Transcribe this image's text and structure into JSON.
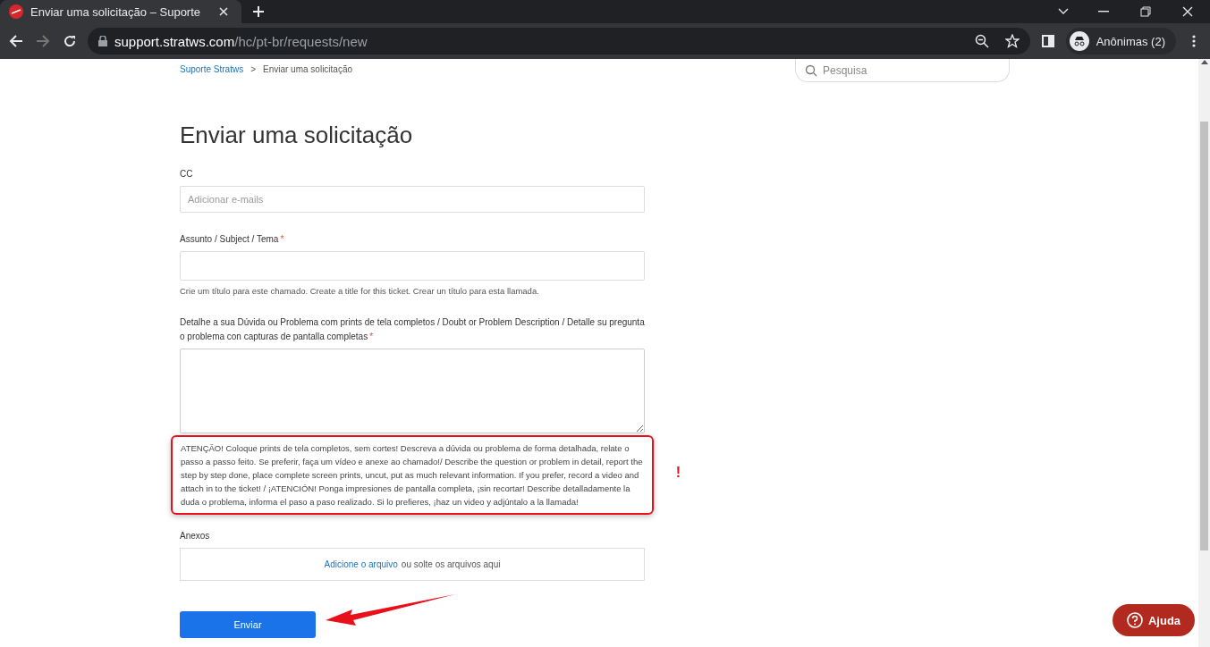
{
  "browser": {
    "tab_title": "Enviar uma solicitação – Suporte",
    "url_host": "support.stratws.com",
    "url_path": "/hc/pt-br/requests/new",
    "profile": "Anônimas (2)"
  },
  "breadcrumbs": [
    {
      "label": "Suporte Stratws",
      "kind": "link"
    },
    {
      "label": ">",
      "kind": "separator"
    },
    {
      "label": "Enviar uma solicitação",
      "kind": "current"
    }
  ],
  "search": {
    "placeholder": "Pesquisa"
  },
  "page_title": "Enviar uma solicitação",
  "fields": [
    {
      "kind": "input",
      "label": "CC",
      "placeholder": "Adicionar e-mails"
    },
    {
      "kind": "input",
      "label": "Assunto / Subject / Tema",
      "required_mark": "*",
      "hint": "Crie um título para este chamado. Create a title for this ticket. Crear un título para esta llamada."
    },
    {
      "kind": "textarea",
      "label": "Detalhe a sua Dúvida ou Problema com prints de tela completos / Doubt or Problem Description / Detalle su pregunta o problema con capturas de pantalla completas",
      "required_mark": "*",
      "warning": "ATENÇÃO! Coloque prints de tela completos, sem cortes! Descreva a dúvida ou problema de forma detalhada, relate o passo a passo feito. Se preferir, faça um vídeo e anexe ao chamado!/ Describe the question or problem in detail, report the step by step done, place complete screen prints, uncut, put as much relevant information. If you prefer, record a video and attach in to the ticket! / ¡ATENCIÓN! Ponga impresiones de pantalla completa, ¡sin recortar! Describe detalladamente la duda o problema, informa el paso a paso realizado. Si lo prefieres, ¡haz un video y adjúntalo a la llamada!",
      "mark": "!"
    },
    {
      "kind": "attachments",
      "label": "Anexos",
      "link": "Adicione o arquivo",
      "text": "ou solte os arquivos aqui"
    }
  ],
  "submit": "Enviar",
  "help_button": "Ajuda"
}
